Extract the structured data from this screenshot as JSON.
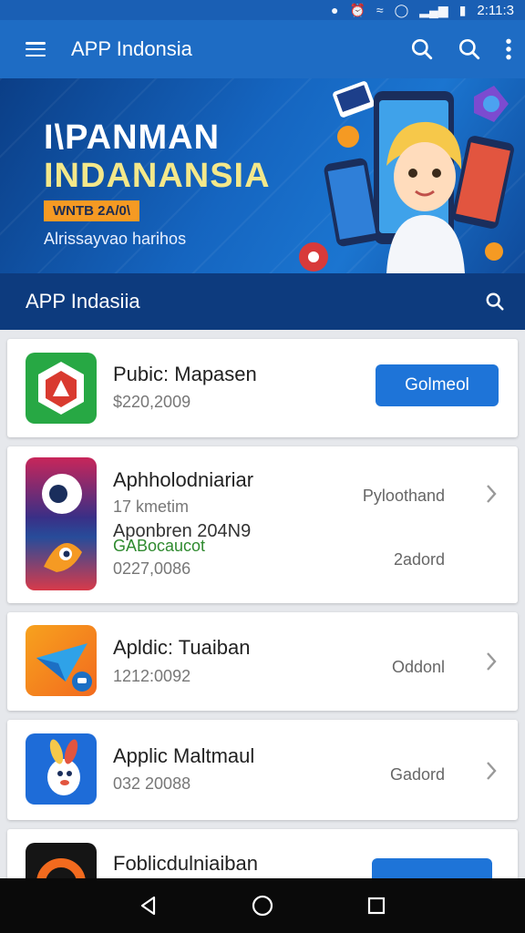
{
  "status_bar": {
    "time": "2:11:3"
  },
  "app_bar": {
    "title": "APP Indonsia",
    "menu_icon": "menu-icon",
    "search_icons": [
      "search-icon",
      "search-icon"
    ],
    "overflow_icon": "more-vert-icon"
  },
  "banner": {
    "headline_1": "I\\PANMAN",
    "headline_2": "INDANANSIA",
    "tag": "WNTB 2A/0\\",
    "subtitle": "Alrissayvao harihos"
  },
  "section": {
    "title": "APP Indasiia",
    "search_icon": "search-icon"
  },
  "apps": [
    {
      "name": "Pubic: Mapasen",
      "meta": "$220,2009",
      "action_label": "Golmeol",
      "icon": "shield-app-icon"
    },
    {
      "name": "Aphholodniariar",
      "meta": "17 kmetim",
      "sub_name": "Aponbren 204N9",
      "sub_meta_green": "GABocaucot",
      "sub_meta": "0227,0086",
      "right_label": "Pyloothand",
      "right_label_2": "2adord",
      "icon": "eye-app-icon"
    },
    {
      "name": "Apldic: Tuaiban",
      "meta": "1212:0092",
      "right_label": "Oddonl",
      "icon": "plane-app-icon"
    },
    {
      "name": "Applic Maltmaul",
      "meta": "032 20088",
      "right_label": "Gadord",
      "icon": "rabbit-app-icon"
    },
    {
      "name": "Foblicdulniaiban",
      "icon": "ring-app-icon"
    }
  ],
  "nav_bar": {
    "back_icon": "back-icon",
    "home_icon": "home-icon",
    "recents_icon": "recents-icon"
  },
  "colors": {
    "primary": "#1e6cc4",
    "section": "#0d3b7e",
    "button": "#1e74d8",
    "banner_accent": "#f59a23"
  }
}
